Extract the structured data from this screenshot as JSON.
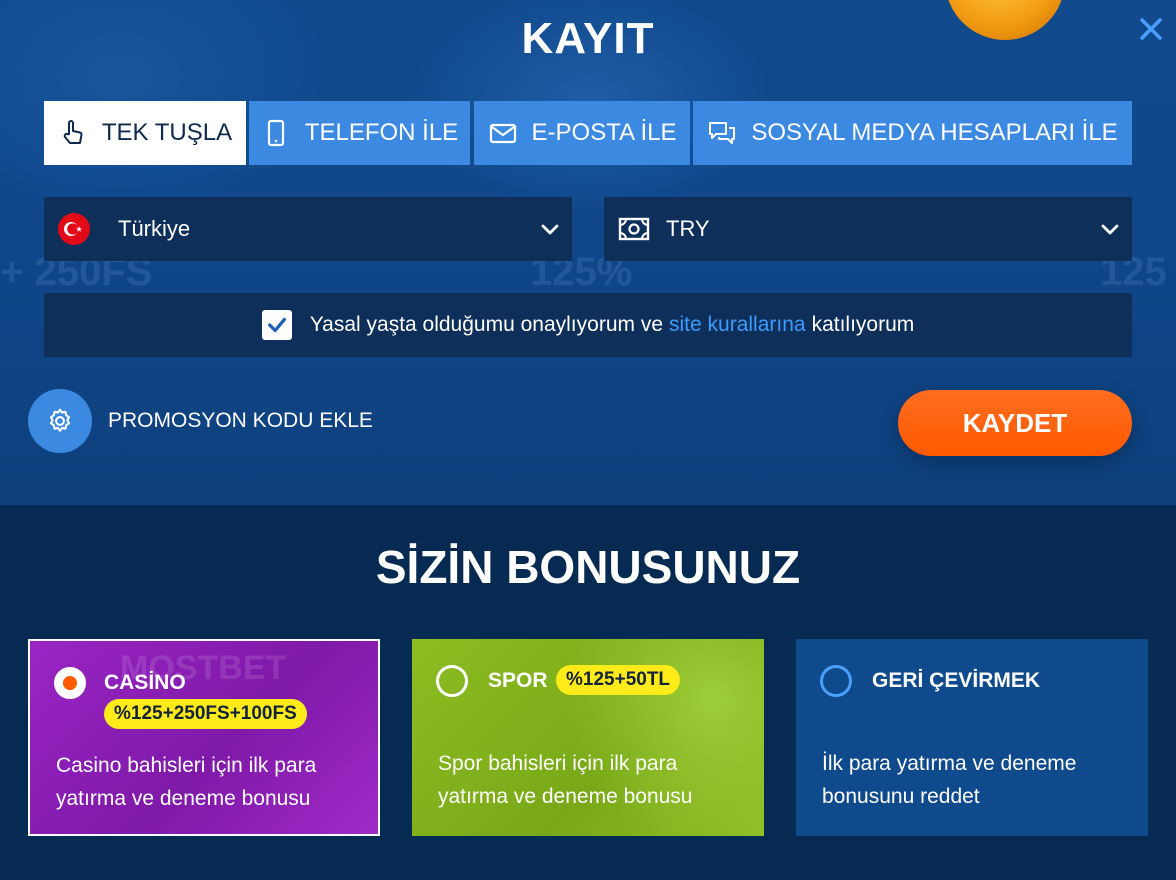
{
  "modal": {
    "title": "KAYIT",
    "tabs": [
      {
        "label": "TEK TUŞLA",
        "icon": "hand-pointer-icon",
        "active": true
      },
      {
        "label": "TELEFON İLE",
        "icon": "phone-icon",
        "active": false
      },
      {
        "label": "E-POSTA İLE",
        "icon": "envelope-icon",
        "active": false
      },
      {
        "label": "SOSYAL MEDYA HESAPLARI İLE",
        "icon": "chat-bubbles-icon",
        "active": false
      }
    ],
    "country": {
      "value": "Türkiye",
      "icon": "turkey-flag-icon"
    },
    "currency": {
      "value": "TRY",
      "icon": "banknote-icon"
    },
    "agreement": {
      "checked": true,
      "text_before": "Yasal yaşta olduğumu onaylıyorum ve",
      "link_text": "site kurallarına",
      "text_after": "katılıyorum"
    },
    "promo_label": "PROMOSYON KODU EKLE",
    "save_label": "KAYDET"
  },
  "bonus": {
    "title": "SİZİN BONUSUNUZ",
    "options": [
      {
        "name": "CASİNO",
        "badge": "%125+250FS+100FS",
        "description": "Casino bahisleri için ilk para yatırma ve deneme bonusu",
        "selected": true
      },
      {
        "name": "SPOR",
        "badge": "%125+50TL",
        "description": "Spor bahisleri için ilk para yatırma ve deneme bonusu",
        "selected": false
      },
      {
        "name": "GERİ ÇEVİRMEK",
        "badge": "",
        "description": "İlk para yatırma ve deneme bonusunu reddet",
        "selected": false
      }
    ]
  },
  "colors": {
    "accent_blue": "#3b89e0",
    "save_orange": "#ff5a00",
    "badge_yellow": "#ffeb1a",
    "casino_purple": "#8b1fb0",
    "sport_green": "#86b51e",
    "decline_blue": "#0f4a8c"
  }
}
